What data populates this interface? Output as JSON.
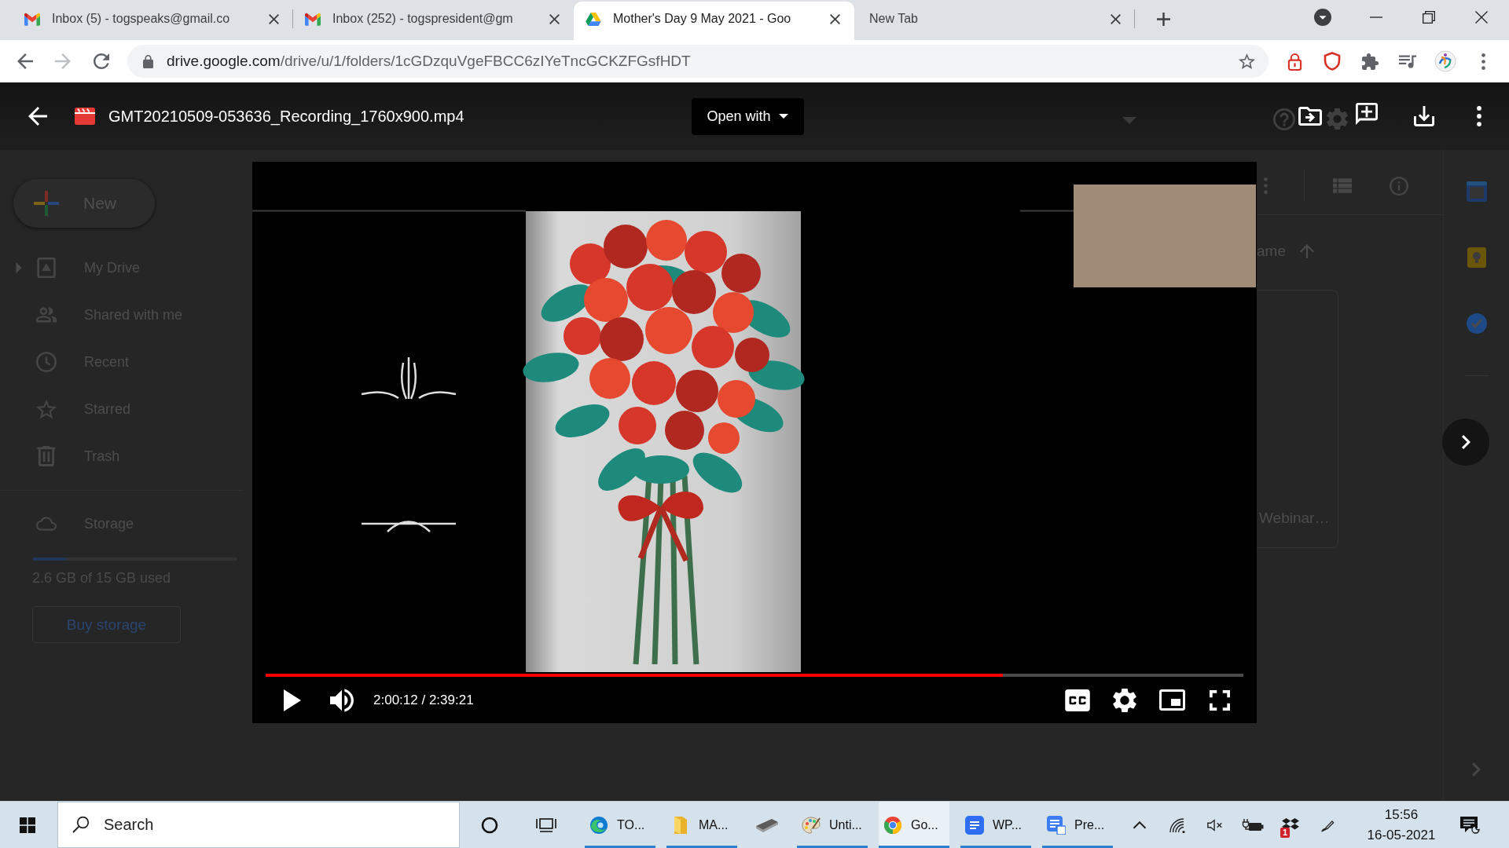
{
  "browser": {
    "tabs": [
      {
        "kind": "mail",
        "title": "Inbox (5) - togspeaks@gmail.co",
        "selected": false
      },
      {
        "kind": "mail",
        "title": "Inbox (252) - togspresident@gm",
        "selected": false
      },
      {
        "kind": "drive",
        "title": "Mother's Day 9 May 2021 - Goo",
        "selected": true
      },
      {
        "kind": "blank",
        "title": "New Tab",
        "selected": false
      }
    ],
    "forward_button": {
      "disabled": true
    },
    "address": {
      "host": "drive.google.com",
      "path": "/drive/u/1/folders/1cGDzquVgeFBCC6zIYeTncGCKZFGsfHDT"
    }
  },
  "viewer": {
    "file_name": "GMT20210509-053636_Recording_1760x900.mp4",
    "open_with": "Open with",
    "player": {
      "playing": false,
      "muted": false,
      "progress": {
        "level": 0.754
      },
      "time": "2:00:12 / 2:39:21"
    }
  },
  "drive": {
    "new_button": "New",
    "nav": [
      {
        "kind": "drive",
        "label": "My Drive",
        "expandable": true
      },
      {
        "kind": "shared",
        "label": "Shared with me",
        "expandable": false
      },
      {
        "kind": "recent",
        "label": "Recent",
        "expandable": false
      },
      {
        "kind": "starred",
        "label": "Starred",
        "expandable": false
      },
      {
        "kind": "trash",
        "label": "Trash",
        "expandable": false
      }
    ],
    "storage": {
      "label": "Storage",
      "level": 0.17,
      "usage": "2.6 GB of 15 GB used",
      "buy_button": "Buy storage"
    },
    "sort_header": "ame",
    "file_card": {
      "name": "Webinar…"
    }
  },
  "taskbar": {
    "search": {
      "placeholder": "Search"
    },
    "apps": [
      {
        "kind": "swirl",
        "label": "TO...",
        "running": true,
        "selected": false
      },
      {
        "kind": "folder",
        "label": "MA...",
        "running": true,
        "selected": false
      },
      {
        "kind": "scanner",
        "running": false,
        "selected": false
      },
      {
        "kind": "palette",
        "label": "Unti...",
        "running": true,
        "selected": false
      },
      {
        "kind": "wheel",
        "label": "Go...",
        "running": true,
        "selected": true
      },
      {
        "kind": "tile",
        "label": "WP...",
        "running": true,
        "selected": false
      },
      {
        "kind": "doc",
        "label": "Pre...",
        "running": true,
        "selected": false
      }
    ],
    "tray": {
      "muted": true,
      "badge": "1"
    },
    "clock": {
      "time": "15:56",
      "date": "16-05-2021"
    }
  }
}
